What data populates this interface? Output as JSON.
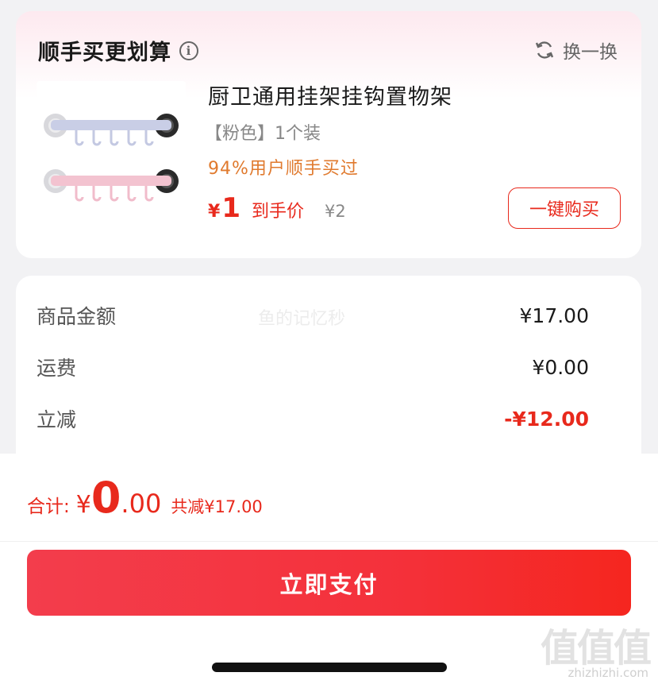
{
  "recommend": {
    "title": "顺手买更划算",
    "info_icon": "info-icon",
    "refresh_label": "换一换",
    "product": {
      "name": "厨卫通用挂架挂钩置物架",
      "spec": "【粉色】1个装",
      "social_proof": "94%用户顺手买过",
      "currency": "¥",
      "price": "1",
      "price_tag": "到手价",
      "original_price": "¥2",
      "buy_label": "一键购买"
    }
  },
  "summary": {
    "watermark": "鱼的记忆秒",
    "rows": [
      {
        "label": "商品金额",
        "value": "¥17.00"
      },
      {
        "label": "运费",
        "value": "¥0.00"
      },
      {
        "label": "立减",
        "value": "-¥12.00"
      }
    ]
  },
  "checkout": {
    "total_label": "合计:",
    "currency": "¥",
    "total_int": "0",
    "total_dec": ".00",
    "saved": "共减¥17.00",
    "pay_label": "立即支付"
  },
  "site_logo": {
    "chars": "值值值",
    "url": "zhizhizhi.com"
  },
  "colors": {
    "accent": "#e8291c",
    "social": "#e07a2e",
    "pay_gradient_start": "#f33d4c",
    "pay_gradient_end": "#f5261f"
  }
}
